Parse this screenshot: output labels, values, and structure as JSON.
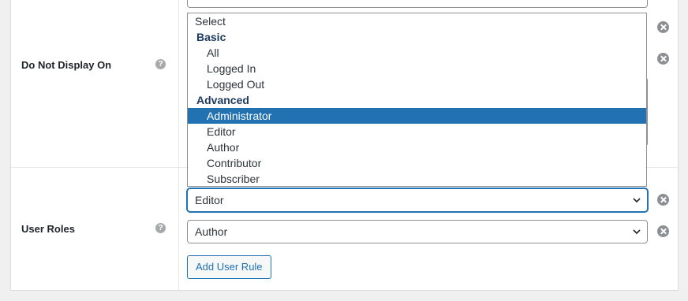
{
  "rules": {
    "do_not_display_on": {
      "label": "Do Not Display On",
      "help": "?"
    },
    "user_roles": {
      "label": "User Roles",
      "help": "?",
      "selects": [
        "Editor",
        "Author"
      ],
      "add_button": "Add User Rule"
    }
  },
  "dropdown": {
    "options": [
      {
        "text": "Select",
        "kind": "placeholder"
      },
      {
        "text": "Basic",
        "kind": "group"
      },
      {
        "text": "All",
        "kind": "option"
      },
      {
        "text": "Logged In",
        "kind": "option"
      },
      {
        "text": "Logged Out",
        "kind": "option"
      },
      {
        "text": "Advanced",
        "kind": "group"
      },
      {
        "text": "Administrator",
        "kind": "option",
        "selected": true
      },
      {
        "text": "Editor",
        "kind": "option"
      },
      {
        "text": "Author",
        "kind": "option"
      },
      {
        "text": "Contributor",
        "kind": "option"
      },
      {
        "text": "Subscriber",
        "kind": "option"
      }
    ]
  },
  "icons": {
    "help": "question-circle-icon",
    "remove": "remove-circle-icon",
    "chevron": "chevron-down-icon"
  },
  "colors": {
    "accent": "#2271b1",
    "group_text": "#1d3a60",
    "remove_icon": "#8c8f94"
  }
}
